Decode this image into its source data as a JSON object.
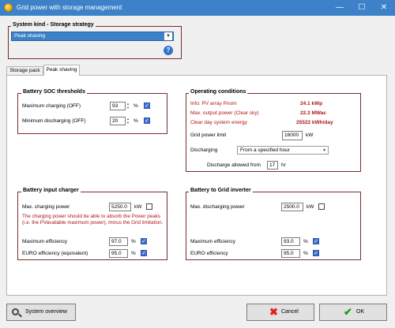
{
  "window": {
    "title": "Grid power with storage management"
  },
  "system_kind": {
    "legend": "System kind - Storage strategy",
    "value": "Peak shaving"
  },
  "tabs": [
    {
      "label": "Storage pack"
    },
    {
      "label": "Peak shaving"
    }
  ],
  "battery_soc": {
    "legend": "Battery SOC thresholds",
    "max_charging_label": "Maximum charging  (OFF)",
    "max_charging_value": "93",
    "min_discharging_label": "Minimum discharging  (OFF)",
    "min_discharging_value": "20",
    "unit": "%"
  },
  "operating": {
    "legend": "Operating conditions",
    "rows": [
      {
        "label": "Info: PV array Pnom",
        "value": "24.1 kWp"
      },
      {
        "label": "Max. output power (Clear sky)",
        "value": "22.3 MWac"
      },
      {
        "label": "Clear day system energy",
        "value": "25522 kWh/day"
      }
    ],
    "grid_limit_label": "Grid power limit",
    "grid_limit_value": "16000",
    "grid_limit_unit": "kW",
    "discharging_label": "Discharging",
    "discharging_value": "From a specified hour",
    "allowed_label": "Discharge allowed from",
    "allowed_value": "17",
    "allowed_unit": "hr"
  },
  "charger": {
    "legend": "Battery input charger",
    "max_power_label": "Max. charging power",
    "max_power_value": "5250.0",
    "max_power_unit": "kW",
    "note": "The charging power should be able to absorb the Power peaks (i.e. the PVavailable maximum power), minus the Grid limitation.",
    "max_eff_label": "Maximum efficiency",
    "max_eff_value": "97.0",
    "euro_eff_label": "EURO efficiency (equivalent)",
    "euro_eff_value": "95.0",
    "unit": "%"
  },
  "inverter": {
    "legend": "Battery to Grid inverter",
    "max_power_label": "Max. discharging power",
    "max_power_value": "2500.0",
    "max_power_unit": "kW",
    "max_eff_label": "Maximum efficiency",
    "max_eff_value": "93.0",
    "euro_eff_label": "EURO efficiency",
    "euro_eff_value": "95.0",
    "unit": "%"
  },
  "buttons": {
    "system_overview": "System overview",
    "cancel": "Cancel",
    "ok": "OK"
  },
  "colors": {
    "accent": "#3d82c8",
    "frame": "#7a2c2c",
    "info_red": "#b01515",
    "check_blue": "#3f6fd0"
  }
}
